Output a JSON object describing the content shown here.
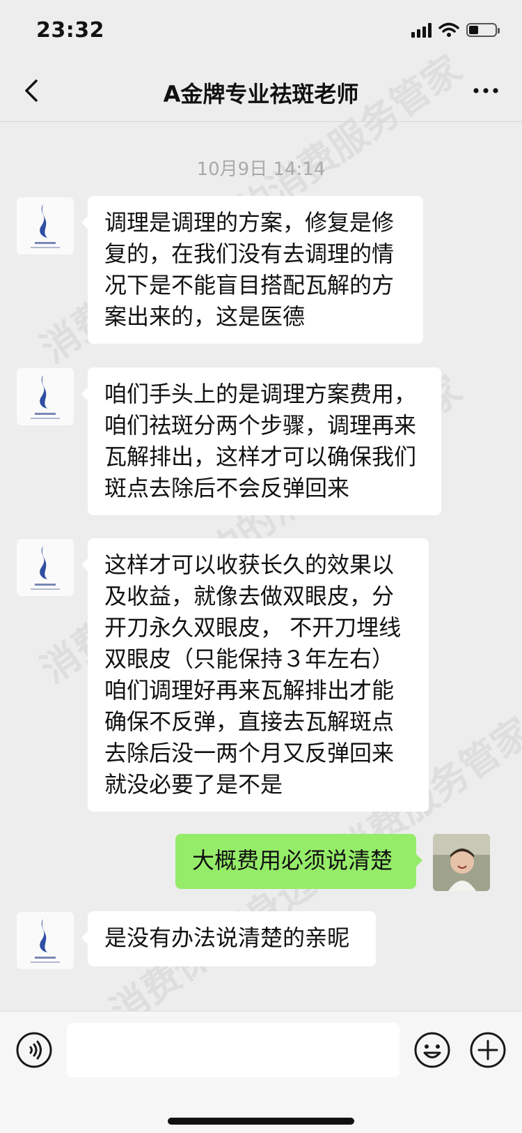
{
  "status_bar": {
    "time": "23:32",
    "battery_level": 0.35
  },
  "header": {
    "title": "A金牌专业祛斑老师"
  },
  "chat": {
    "timestamp": "10月9日 14:14",
    "messages": [
      {
        "sender": "contact",
        "text": "调理是调理的方案，修复是修复的，在我们没有去调理的情况下是不能盲目搭配瓦解的方案出来的，这是医德"
      },
      {
        "sender": "contact",
        "text": "咱们手头上的是调理方案费用，咱们祛斑分两个步骤，调理再来瓦解排出，这样才可以确保我们斑点去除后不会反弹回来"
      },
      {
        "sender": "contact",
        "text": "这样才可以收获长久的效果以及收益，就像去做双眼皮，分开刀永久双眼皮， 不开刀埋线双眼皮（只能保持３年左右）咱们调理好再来瓦解排出才能确保不反弹，直接去瓦解斑点去除后没一两个月又反弹回来就没必要了是不是"
      },
      {
        "sender": "me",
        "text": "大概费用必须说清楚"
      },
      {
        "sender": "contact",
        "text": "是没有办法说清楚的亲昵"
      }
    ]
  },
  "input_bar": {
    "placeholder": ""
  },
  "watermark": {
    "text": "消费保 您身边的消费服务管家"
  },
  "colors": {
    "background": "#ededed",
    "incoming_bubble": "#ffffff",
    "outgoing_bubble": "#95ec69",
    "timestamp": "#a9a9a9"
  },
  "icons": {
    "back": "chevron-left-icon",
    "more": "more-dots-icon",
    "voice": "voice-icon",
    "emoji": "emoji-icon",
    "plus": "plus-icon"
  }
}
